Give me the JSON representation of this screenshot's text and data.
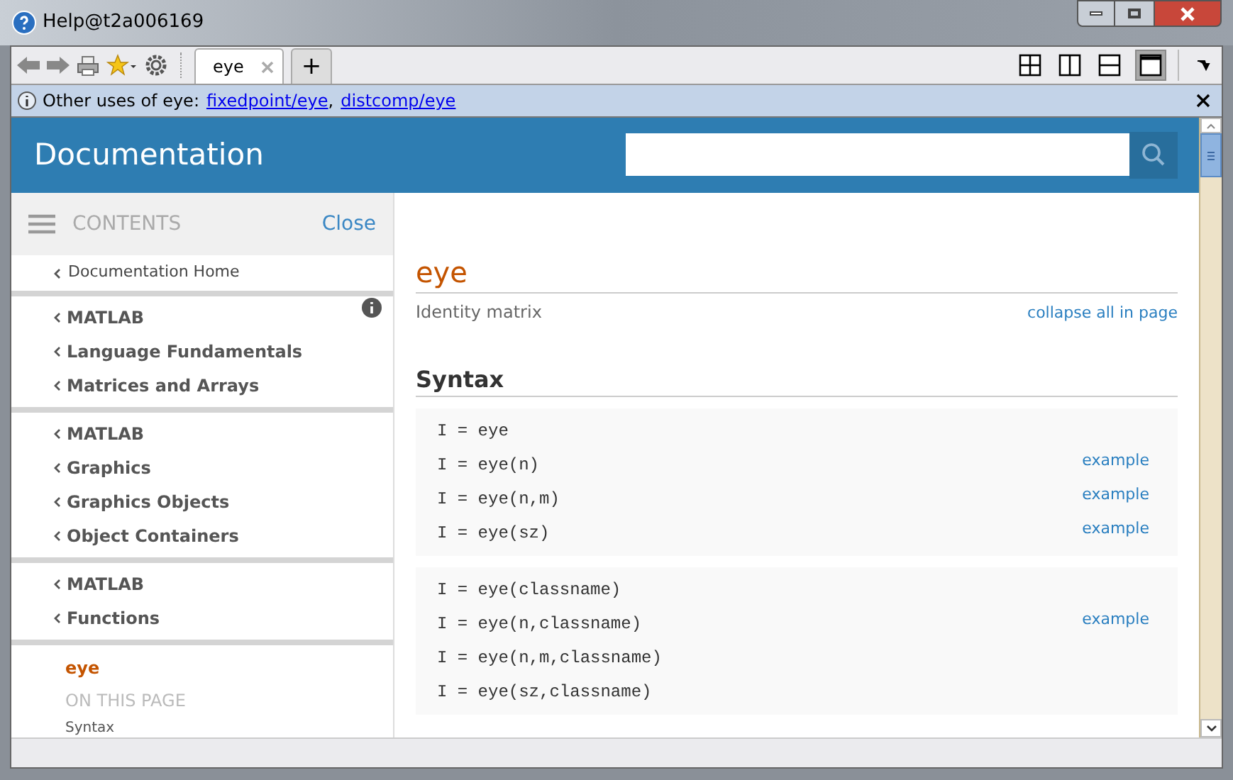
{
  "window": {
    "title": "Help@t2a006169"
  },
  "tabs": [
    {
      "label": "eye",
      "selected": true
    }
  ],
  "new_tab": "+",
  "layout_buttons": [
    {
      "kind": "grid",
      "selected": false
    },
    {
      "kind": "columns",
      "selected": false
    },
    {
      "kind": "rows",
      "selected": false
    },
    {
      "kind": "single",
      "selected": true
    }
  ],
  "info_bar": {
    "text": "Other uses of eye:",
    "links": [
      "fixedpoint/eye",
      "distcomp/eye"
    ],
    "separator": ","
  },
  "header": {
    "title": "Documentation"
  },
  "sidebar": {
    "title": "CONTENTS",
    "close": "Close",
    "home": "Documentation Home",
    "groups": [
      [
        "MATLAB",
        "Language Fundamentals",
        "Matrices and Arrays"
      ],
      [
        "MATLAB",
        "Graphics",
        "Graphics Objects",
        "Object Containers"
      ],
      [
        "MATLAB",
        "Functions"
      ]
    ],
    "current": "eye",
    "on_this_page": "ON THIS PAGE",
    "sections": [
      "Syntax"
    ]
  },
  "page": {
    "title": "eye",
    "subtitle": "Identity matrix",
    "collapse": "collapse all in page",
    "section": "Syntax",
    "blocks": [
      [
        {
          "code": "I = eye"
        },
        {
          "code": "I = eye(n)",
          "example": "example"
        },
        {
          "code": "I = eye(n,m)",
          "example": "example"
        },
        {
          "code": "I = eye(sz)",
          "example": "example"
        }
      ],
      [
        {
          "code": "I = eye(classname)"
        },
        {
          "code": "I = eye(n,classname)",
          "example": "example"
        },
        {
          "code": "I = eye(n,m,classname)"
        },
        {
          "code": "I = eye(sz,classname)"
        }
      ]
    ]
  }
}
